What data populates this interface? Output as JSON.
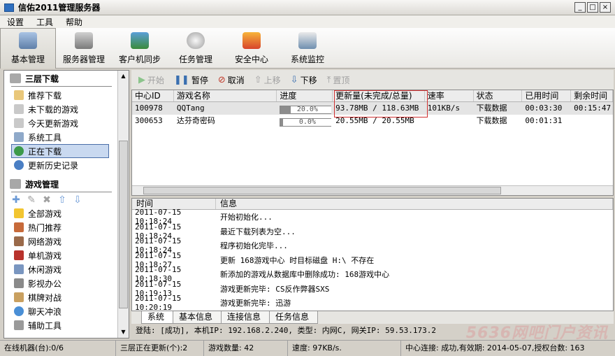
{
  "app": {
    "title": "信佑2011管理服务器"
  },
  "window_buttons": {
    "minimize": "_",
    "maximize": "□",
    "close": "×"
  },
  "menu": [
    "设置",
    "工具",
    "帮助"
  ],
  "toolbar": [
    {
      "label": "基本管理",
      "icon": "basic-management-icon",
      "active": true
    },
    {
      "label": "服务器管理",
      "icon": "server-management-icon"
    },
    {
      "label": "客户机同步",
      "icon": "client-sync-icon"
    },
    {
      "label": "任务管理",
      "icon": "task-management-icon"
    },
    {
      "label": "安全中心",
      "icon": "security-shield-icon"
    },
    {
      "label": "系统监控",
      "icon": "system-monitor-icon"
    }
  ],
  "sidebar": {
    "section1": "三层下载",
    "items1": [
      "推荐下载",
      "未下载的游戏",
      "今天更新游戏",
      "系统工具",
      "正在下载",
      "更新历史记录"
    ],
    "selected": "正在下载",
    "section2": "游戏管理",
    "items2": [
      "全部游戏",
      "热门推荐",
      "网络游戏",
      "单机游戏",
      "休闲游戏",
      "影视办公",
      "棋牌对战",
      "聊天冲浪",
      "辅助工具"
    ]
  },
  "actions": {
    "start": "开始",
    "pause": "暂停",
    "cancel": "取消",
    "up": "上移",
    "down": "下移",
    "top": "置顶"
  },
  "grid": {
    "headers": [
      "中心ID",
      "游戏名称",
      "进度",
      "更新量(未完成/总量)",
      "速率",
      "状态",
      "已用时间",
      "剩余时间"
    ],
    "rows": [
      {
        "id": "100978",
        "name": "QQTang",
        "progress": "20.0%",
        "progress_value": 20,
        "size": "93.78MB / 118.63MB",
        "rate": "101KB/s",
        "status": "下载数据",
        "used": "00:03:30",
        "remain": "00:15:47"
      },
      {
        "id": "300653",
        "name": "达芬奇密码",
        "progress": "0.0%",
        "progress_value": 0,
        "size": "20.55MB / 20.55MB",
        "rate": "",
        "status": "下载数据",
        "used": "00:01:31",
        "remain": ""
      }
    ]
  },
  "log": {
    "headers": [
      "时间",
      "信息"
    ],
    "rows": [
      {
        "time": "2011-07-15 10:18:24",
        "info": "开始初始化..."
      },
      {
        "time": "2011-07-15 10:18:24",
        "info": "最近下载列表为空..."
      },
      {
        "time": "2011-07-15 10:18:24",
        "info": "程序初始化完毕..."
      },
      {
        "time": "2011-07-15 10:18:27",
        "info": "更新 168游戏中心 时目标磁盘 H:\\ 不存在"
      },
      {
        "time": "2011-07-15 10:18:30",
        "info": "新添加的游戏从数据库中删除成功: 168游戏中心"
      },
      {
        "time": "2011-07-15 10:19:13",
        "info": "游戏更新完毕: CS反作弊器SXS"
      },
      {
        "time": "2011-07-15 10:20:19",
        "info": "游戏更新完毕: 迅游"
      }
    ]
  },
  "tabs": [
    "系统",
    "基本信息",
    "连接信息",
    "任务信息"
  ],
  "login_info": "登陆: [成功], 本机IP: 192.168.2.240, 类型: 内网C, 网关IP: 59.53.173.2",
  "status": {
    "online": "在线机器(台):0/6",
    "updating": "三层正在更新(个):2",
    "game_count": "游戏数量: 42",
    "speed": "速度: 97KB/s.",
    "center": "中心连接: 成功,有效期: 2014-05-07,授权台数: 163"
  },
  "watermark": "5636网吧门户资讯"
}
